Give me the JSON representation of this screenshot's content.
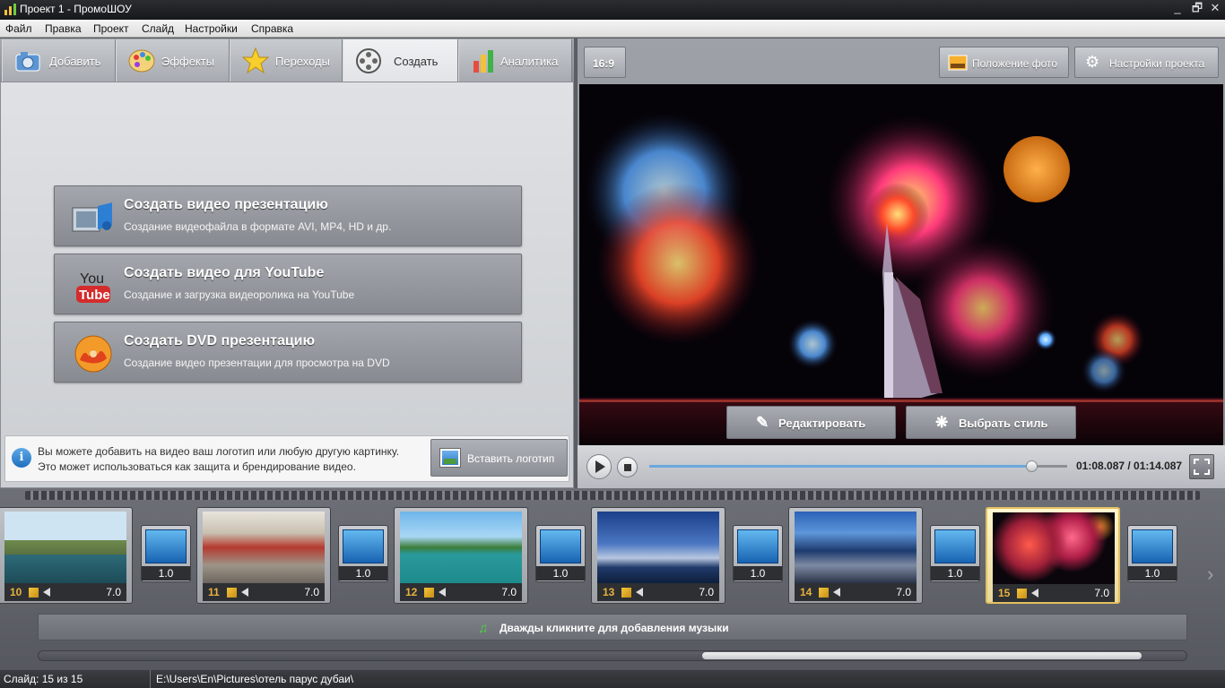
{
  "window": {
    "title": "Проект 1 - ПромоШОУ",
    "controls": [
      "_",
      "🗗",
      "✕"
    ]
  },
  "menu": [
    "Файл",
    "Правка",
    "Проект",
    "Слайд",
    "Настройки",
    "Справка"
  ],
  "tabs": [
    {
      "label": "Добавить",
      "icon": "camera-icon"
    },
    {
      "label": "Эффекты",
      "icon": "palette-icon"
    },
    {
      "label": "Переходы",
      "icon": "star-icon"
    },
    {
      "label": "Создать",
      "icon": "film-reel-icon",
      "active": true
    },
    {
      "label": "Аналитика",
      "icon": "bar-chart-icon"
    }
  ],
  "create_options": [
    {
      "title": "Создать видео презентацию",
      "subtitle": "Создание видеофайла в формате AVI, MP4, HD и др.",
      "icon": "video-file-icon"
    },
    {
      "title": "Создать видео для YouTube",
      "subtitle": "Создание и загрузка видеоролика на YouTube",
      "icon": "youtube-icon"
    },
    {
      "title": "Создать DVD презентацию",
      "subtitle": "Создание видео презентации для просмотра на DVD",
      "icon": "dvd-icon"
    }
  ],
  "info": {
    "line1": "Вы можете добавить на видео ваш логотип или любую другую картинку.",
    "line2": "Это может использоваться как защита и брендирование видео.",
    "button": "Вставить логотип"
  },
  "preview_toolbar": {
    "aspect": "16:9",
    "photo_position": "Положение фото",
    "project_settings": "Настройки проекта"
  },
  "preview_actions": {
    "edit": "Редактировать",
    "style": "Выбрать стиль"
  },
  "player": {
    "timecode": "01:08.087 / 01:14.087",
    "progress": 0.917
  },
  "slides": [
    {
      "num": "10",
      "duration": "7.0",
      "selected": false
    },
    {
      "num": "11",
      "duration": "7.0",
      "selected": false
    },
    {
      "num": "12",
      "duration": "7.0",
      "selected": false
    },
    {
      "num": "13",
      "duration": "7.0",
      "selected": false
    },
    {
      "num": "14",
      "duration": "7.0",
      "selected": false
    },
    {
      "num": "15",
      "duration": "7.0",
      "selected": true
    }
  ],
  "transitions": [
    "1.0",
    "1.0",
    "1.0",
    "1.0",
    "1.0",
    "1.0"
  ],
  "music_hint": "Дважды кликните для добавления музыки",
  "status": {
    "slide": "Слайд: 15 из 15",
    "path": "E:\\Users\\En\\Pictures\\отель парус дубаи\\"
  },
  "colors": {
    "accent": "#6aa8dd",
    "slide_number": "#e8b23d",
    "selection": "#e3c060"
  }
}
